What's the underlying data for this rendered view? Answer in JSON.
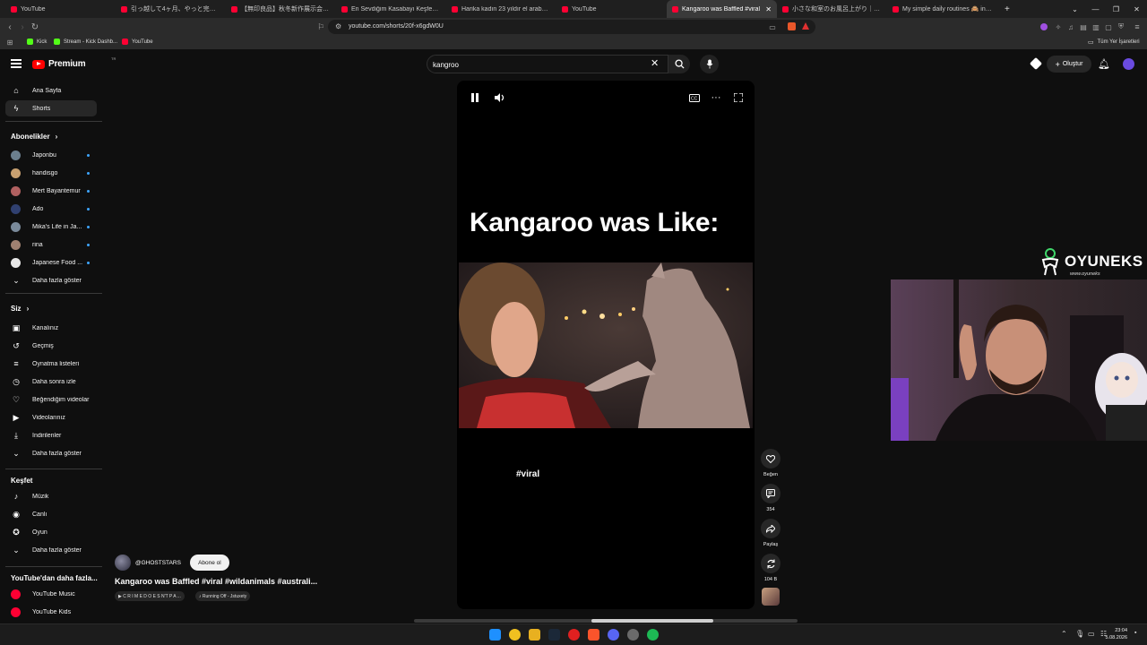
{
  "browser": {
    "tabs": [
      {
        "title": "YouTube",
        "color": "#ff0033"
      },
      {
        "title": "引っ越して4ヶ月、やっと完全ってきた生活",
        "color": "#ff0033"
      },
      {
        "title": "【無印良品】秋冬新作展示会レビュー！",
        "color": "#ff0033"
      },
      {
        "title": "En Sevdiğim Kasabayı Keşfediyorum",
        "color": "#ff0033"
      },
      {
        "title": "Harika kadın 23 yıldır el arabasıyla",
        "color": "#ff0033"
      },
      {
        "title": "YouTube",
        "color": "#ff0033"
      },
      {
        "title": "Kangaroo was Baffled #viral",
        "color": "#ff0033",
        "active": true
      },
      {
        "title": "小さな和室のお風呂上がり｜数次例が",
        "color": "#ff0033"
      },
      {
        "title": "My simple daily routines 🙈 in our",
        "color": "#ff0033"
      }
    ],
    "new_tab": "+",
    "url": "youtube.com/shorts/20f-x6gdW0U",
    "bookmarks": [
      {
        "label": "Kick",
        "color": "#53fc18"
      },
      {
        "label": "Stream - Kick Dashb...",
        "color": "#53fc18"
      },
      {
        "label": "YouTube",
        "color": "#ff0033"
      }
    ],
    "all_bookmarks": "Tüm Yer İşaretleri"
  },
  "masthead": {
    "logo_text": "Premium",
    "region": "TR",
    "search_value": "kangroo",
    "create_label": "Oluştur"
  },
  "sidebar": {
    "main": [
      {
        "label": "Ana Sayfa",
        "icon": "home-icon",
        "glyph": "⌂"
      },
      {
        "label": "Shorts",
        "icon": "shorts-icon",
        "glyph": "ϟ",
        "active": true
      }
    ],
    "subs_heading": "Abonelikler",
    "subs": [
      {
        "label": "Japonbu",
        "color": "#6b7f8e"
      },
      {
        "label": "handisgo",
        "color": "#c8a070"
      },
      {
        "label": "Mert Bayantemur",
        "color": "#b06060"
      },
      {
        "label": "Ado",
        "color": "#304070"
      },
      {
        "label": "Mika's Life in Ja...",
        "color": "#7a8a9a"
      },
      {
        "label": "rina",
        "color": "#a08070"
      },
      {
        "label": "Japanese Food ...",
        "color": "#e8e8e8"
      }
    ],
    "subs_more": "Daha fazla göster",
    "you_heading": "Siz",
    "you": [
      {
        "label": "Kanalınız",
        "icon": "your-channel-icon",
        "glyph": "▣"
      },
      {
        "label": "Geçmiş",
        "icon": "history-icon",
        "glyph": "↺"
      },
      {
        "label": "Oynatma listeleri",
        "icon": "playlists-icon",
        "glyph": "≡"
      },
      {
        "label": "Daha sonra izle",
        "icon": "watch-later-icon",
        "glyph": "◷"
      },
      {
        "label": "Beğendiğim videolar",
        "icon": "liked-icon",
        "glyph": "♡"
      },
      {
        "label": "Videolarınız",
        "icon": "your-videos-icon",
        "glyph": "▶"
      },
      {
        "label": "İndirilenler",
        "icon": "downloads-icon",
        "glyph": "⤓"
      },
      {
        "label": "Daha fazla göster",
        "icon": "chevron-down-icon",
        "glyph": "⌄"
      }
    ],
    "explore_heading": "Keşfet",
    "explore": [
      {
        "label": "Müzik",
        "icon": "music-icon",
        "glyph": "♪"
      },
      {
        "label": "Canlı",
        "icon": "live-icon",
        "glyph": "◉"
      },
      {
        "label": "Oyun",
        "icon": "gaming-icon",
        "glyph": "✪"
      },
      {
        "label": "Daha fazla göster",
        "icon": "chevron-down-icon",
        "glyph": "⌄"
      }
    ],
    "more_heading": "YouTube'dan daha fazla...",
    "more": [
      {
        "label": "YouTube Music",
        "color": "#ff0033"
      },
      {
        "label": "YouTube Kids",
        "color": "#ff0033"
      }
    ]
  },
  "short": {
    "overlay_title": "Kangaroo was Like:",
    "hashtag_overlay": "#viral",
    "channel": "@GHOSTSTARS",
    "subscribe": "Abone ol",
    "title": "Kangaroo was Baffled #viral #wildanimals  #australi...",
    "chips": [
      {
        "label": "▶ C R I M E D O E S N'T P A ..."
      },
      {
        "label": "♪ Running Off - Jstuxety"
      }
    ],
    "actions": {
      "like_label": "Beğen",
      "comments_count": "354",
      "share_label": "Paylaş",
      "remix_count": "104 B"
    }
  },
  "overlay": {
    "brand": "OYUNEKS",
    "brand_url": "www.oyuneks"
  },
  "taskbar": {
    "time": "23:04",
    "date": "5.08.2026"
  }
}
